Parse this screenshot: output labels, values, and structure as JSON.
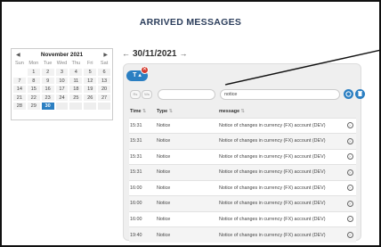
{
  "title": "ARRIVED MESSAGES",
  "calendar": {
    "month_label": "November 2021",
    "prev_icon": "chevron-left-icon",
    "next_icon": "chevron-right-icon",
    "weekdays": [
      "Sun",
      "Mon",
      "Tue",
      "Wed",
      "Thu",
      "Fri",
      "Sat"
    ],
    "days": [
      "",
      "1",
      "2",
      "3",
      "4",
      "5",
      "6",
      "7",
      "8",
      "9",
      "10",
      "11",
      "12",
      "13",
      "14",
      "15",
      "16",
      "17",
      "18",
      "19",
      "20",
      "21",
      "22",
      "23",
      "24",
      "25",
      "26",
      "27",
      "28",
      "29",
      "30",
      "",
      "",
      "",
      ""
    ],
    "selected_day": "30"
  },
  "date_nav": {
    "prev": "←",
    "date": "30/11/2021",
    "next": "→"
  },
  "filter": {
    "icon": "filter-icon",
    "label": "T ▴",
    "badge_icon": "close-icon",
    "badge": "✕"
  },
  "toolbar": {
    "pills": [
      "Rs",
      "Ws"
    ],
    "input_one": "",
    "input_two": "notice",
    "button_a_icon": "refresh-icon",
    "button_b_icon": "trash-icon"
  },
  "table": {
    "headers": {
      "time": "Time",
      "type": "Type",
      "message": "message"
    },
    "sort_icon": "⇅",
    "rows": [
      {
        "time": "15:31",
        "type": "Notice",
        "message": "Notice of changes in currency (FX) account (DEV)"
      },
      {
        "time": "15:31",
        "type": "Notice",
        "message": "Notice of changes in currency (FX) account (DEV)"
      },
      {
        "time": "15:31",
        "type": "Notice",
        "message": "Notice of changes in currency (FX) account (DEV)"
      },
      {
        "time": "15:31",
        "type": "Notice",
        "message": "Notice of changes in currency (FX) account (DEV)"
      },
      {
        "time": "16:00",
        "type": "Notice",
        "message": "Notice of changes in currency (FX) account (DEV)"
      },
      {
        "time": "16:00",
        "type": "Notice",
        "message": "Notice of changes in currency (FX) account (DEV)"
      },
      {
        "time": "16:00",
        "type": "Notice",
        "message": "Notice of changes in currency (FX) account (DEV)"
      },
      {
        "time": "19:40",
        "type": "Notice",
        "message": "Notice of changes in currency (FX) account (DEV)"
      }
    ]
  },
  "colors": {
    "accent": "#2b7fc2",
    "badge": "#d43b2e",
    "title": "#2c3e5c"
  }
}
